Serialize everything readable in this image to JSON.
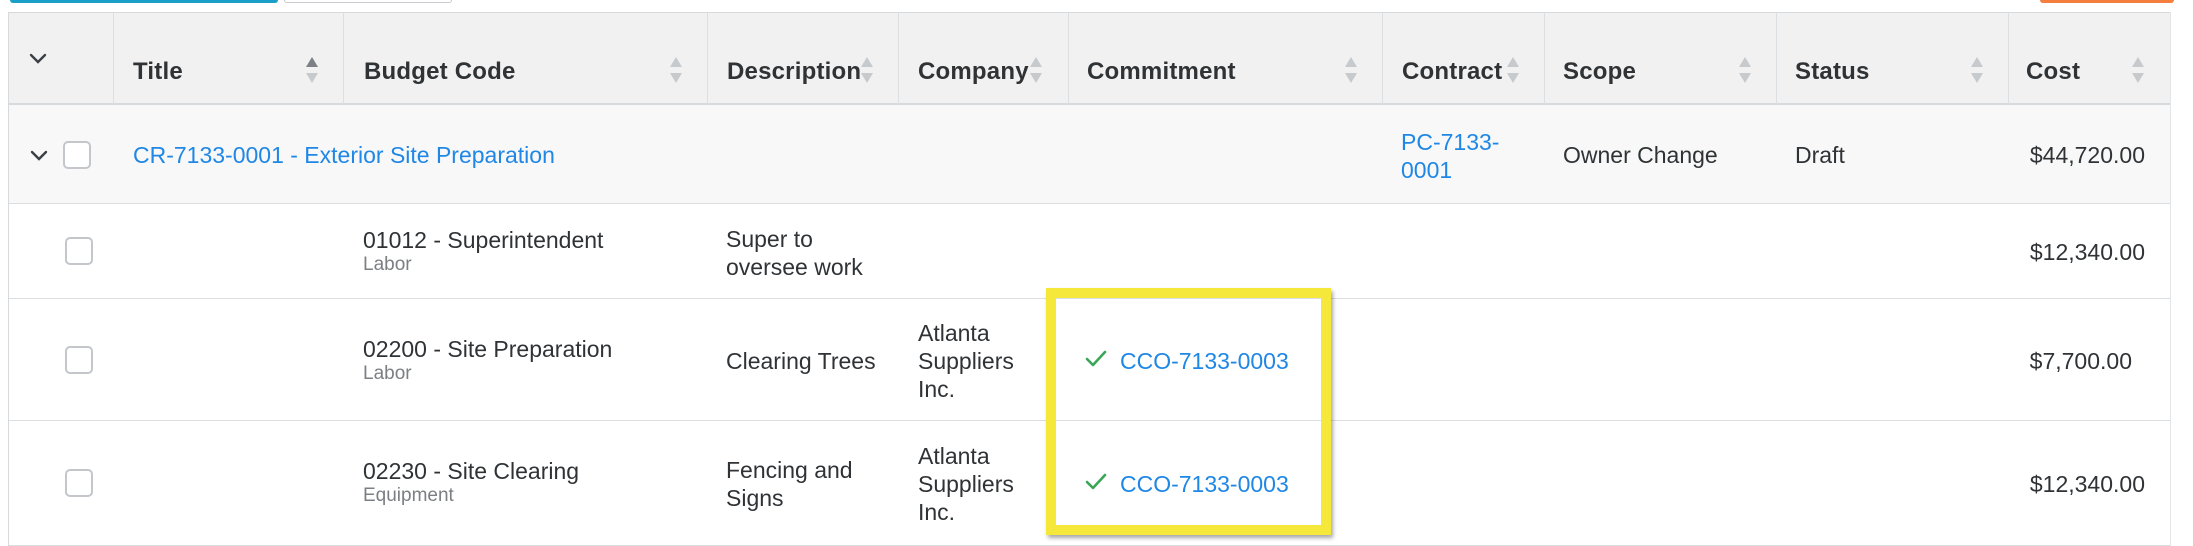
{
  "header": {
    "columns": [
      {
        "label": "Title"
      },
      {
        "label": "Budget Code"
      },
      {
        "label": "Description"
      },
      {
        "label": "Company"
      },
      {
        "label": "Commitment"
      },
      {
        "label": "Contract"
      },
      {
        "label": "Scope"
      },
      {
        "label": "Status"
      },
      {
        "label": "Cost"
      }
    ]
  },
  "parent_row": {
    "title": "CR-7133-0001 - Exterior Site Preparation",
    "contract_line1": "PC-7133-",
    "contract_line2": "0001",
    "scope": "Owner Change",
    "status": "Draft",
    "cost": "$44,720.00"
  },
  "line_items": [
    {
      "budget_code": "01012 - Superintendent",
      "cost_type": "Labor",
      "description_line1": "Super to",
      "description_line2": "oversee work",
      "cost": "$12,340.00"
    },
    {
      "budget_code": "02200 - Site Preparation",
      "cost_type": "Labor",
      "description_line1": "Clearing Trees",
      "company_line1": "Atlanta",
      "company_line2": "Suppliers",
      "company_line3": "Inc.",
      "commitment": "CCO-7133-0003",
      "cost": "$7,700.00"
    },
    {
      "budget_code": "02230 - Site Clearing",
      "cost_type": "Equipment",
      "description_line1": "Fencing and",
      "description_line2": "Signs",
      "company_line1": "Atlanta",
      "company_line2": "Suppliers",
      "company_line3": "Inc.",
      "commitment": "CCO-7133-0003",
      "cost": "$12,340.00"
    }
  ],
  "icons": {
    "expand": "chevron-down-icon",
    "sort": "sort-arrows-icon",
    "commitment_status": "check-icon"
  },
  "colors": {
    "link": "#1f87e5",
    "check": "#3aa757",
    "highlight": "#f6e83a",
    "header_bg": "#f1f1f1"
  }
}
